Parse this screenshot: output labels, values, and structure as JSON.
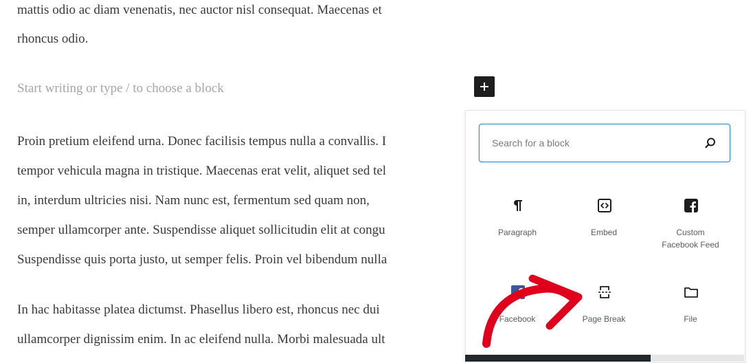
{
  "editor": {
    "paragraphs_top": [
      "mattis odio ac diam venenatis, nec auctor nisl consequat. Maecenas et",
      "rhoncus odio."
    ],
    "placeholder": "Start writing or type / to choose a block",
    "paragraph2": [
      "Proin pretium eleifend urna. Donec facilisis tempus nulla a convallis. I",
      "tempor vehicula magna in tristique. Maecenas erat velit, aliquet sed tel",
      "in, interdum ultricies nisi. Nam nunc est, fermentum sed quam non,",
      "semper ullamcorper ante. Suspendisse aliquet sollicitudin elit at congu",
      "Suspendisse quis porta justo, ut semper felis. Proin vel bibendum nulla"
    ],
    "paragraph3": [
      "In hac habitasse platea dictumst. Phasellus libero est, rhoncus nec dui",
      "ullamcorper dignissim enim. In ac eleifend nulla. Morbi malesuada ult"
    ]
  },
  "inserter": {
    "search_placeholder": "Search for a block",
    "blocks": [
      {
        "label": "Paragraph",
        "icon": "paragraph-icon"
      },
      {
        "label": "Embed",
        "icon": "embed-icon"
      },
      {
        "label": "Custom\nFacebook Feed",
        "icon": "facebook-icon"
      },
      {
        "label": "Facebook",
        "icon": "facebook-icon"
      },
      {
        "label": "Page Break",
        "icon": "page-break-icon"
      },
      {
        "label": "File",
        "icon": "folder-icon"
      }
    ]
  },
  "colors": {
    "search_border": "#2b8ed1",
    "facebook_blue": "#3b5998",
    "annotation_arrow": "#e0001b"
  }
}
